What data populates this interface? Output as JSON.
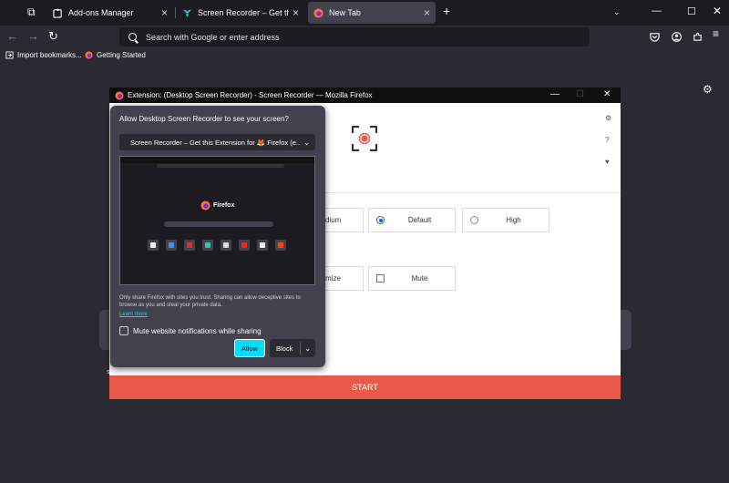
{
  "browser": {
    "tabs": [
      {
        "label": "Add-ons Manager",
        "active": false
      },
      {
        "label": "Screen Recorder – Get this Exte",
        "active": false
      },
      {
        "label": "New Tab",
        "active": true
      }
    ],
    "new_tab_glyph": "+",
    "url_placeholder": "Search with Google or enter address",
    "bookmarks": [
      "Import bookmarks...",
      "Getting Started"
    ]
  },
  "extension_window": {
    "title": "Extension: (Desktop Screen Recorder) - Screen Recorder — Mozilla Firefox",
    "options_row1": [
      {
        "label": "dium",
        "selected": false
      },
      {
        "label": "Default",
        "selected": true
      },
      {
        "label": "High",
        "selected": false
      }
    ],
    "options_row2": [
      {
        "label": "mize"
      },
      {
        "label": "Mute"
      }
    ],
    "start_label": "START"
  },
  "permission_popup": {
    "question": "Allow Desktop Screen Recorder to see your screen?",
    "selected_source": "Screen Recorder – Get this Extension for 🦊 Firefox (e...",
    "preview_brand": "Firefox",
    "warning": "Only share Firefox with sites you trust. Sharing can allow deceptive sites to browse as you and steal your private data.",
    "learn_more": "Learn more",
    "mute_label": "Mute website notifications while sharing",
    "mute_checked": false,
    "allow_label": "Allow",
    "block_label": "Block"
  },
  "colors": {
    "accent_allow": "#00ddff",
    "start_bar": "#e8594a",
    "record_dot": "#e8594a"
  }
}
